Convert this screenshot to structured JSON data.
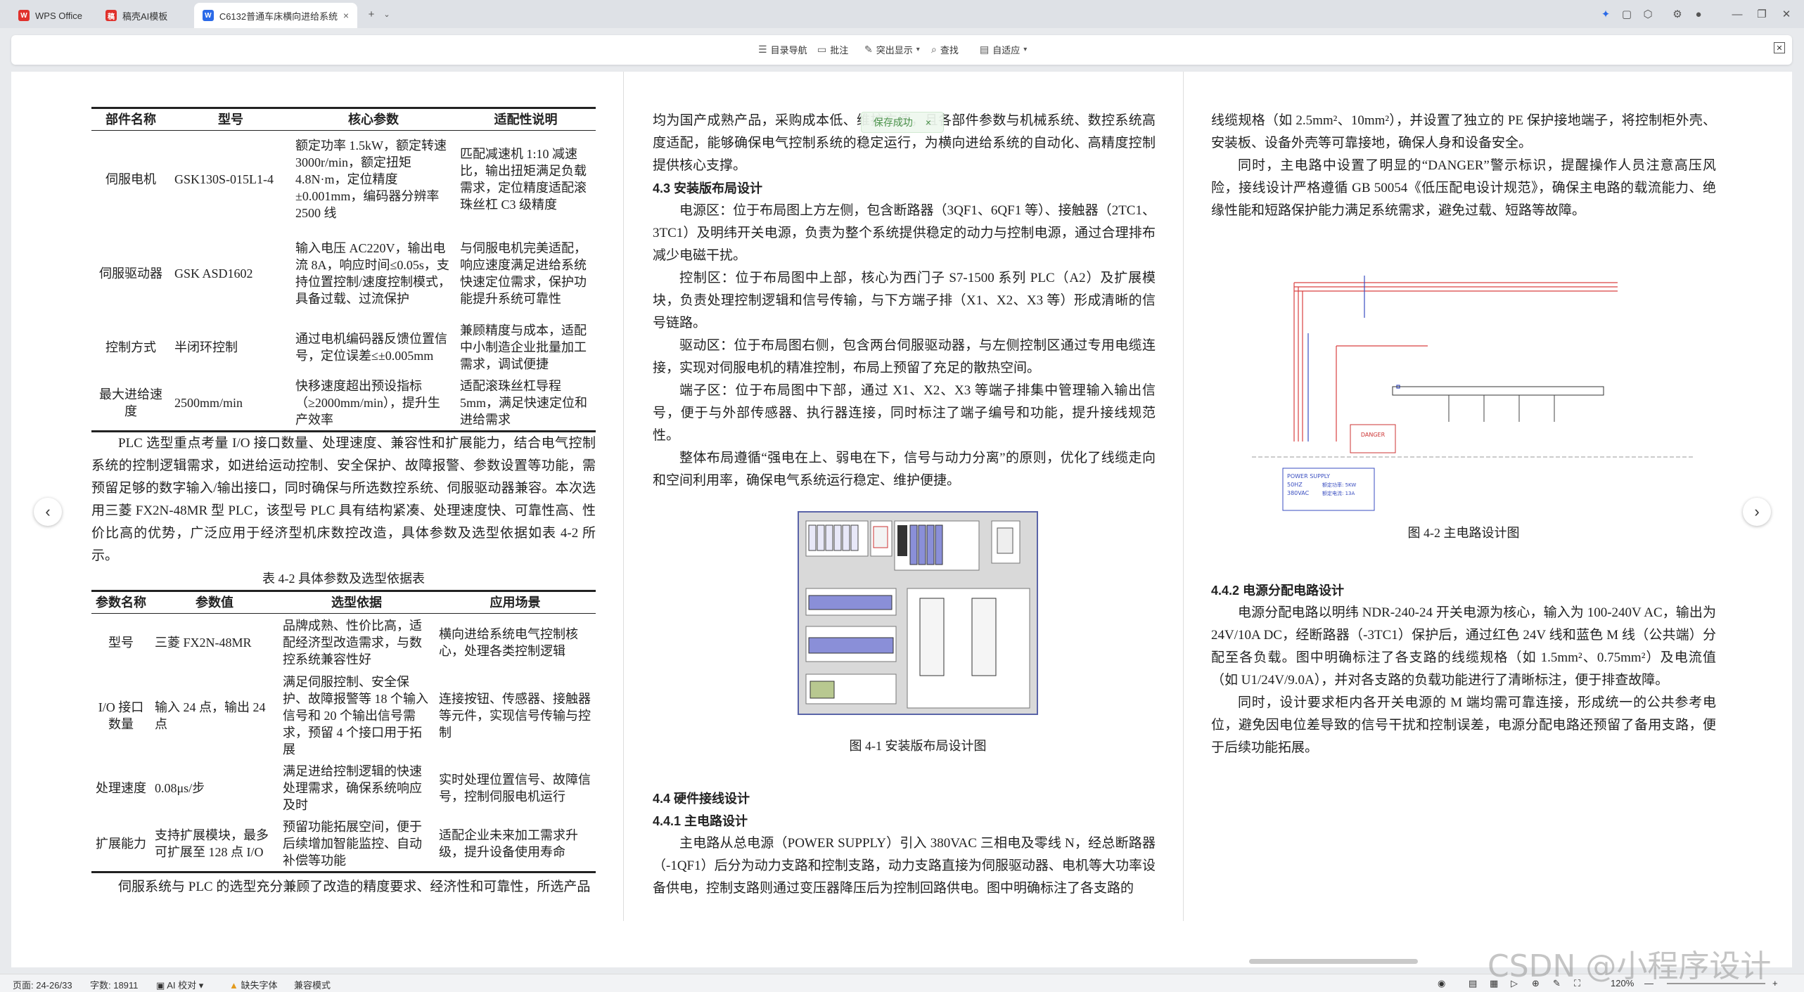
{
  "tabs": [
    {
      "label": "WPS Office",
      "icon": "W",
      "color": "#e0312c"
    },
    {
      "label": "稿壳AI模板",
      "icon": "稿",
      "color": "#e0312c"
    },
    {
      "label": "C6132普通车床横向进给系统",
      "icon": "W",
      "color": "#2b6ae8"
    }
  ],
  "toolbar": {
    "nav": "目录导航",
    "comment": "批注",
    "highlight": "突出显示",
    "find": "查找",
    "adaptive": "自适应"
  },
  "toast": {
    "text": "保存成功",
    "close": "×"
  },
  "col1": {
    "table1": {
      "headers": [
        "部件名称",
        "型号",
        "核心参数",
        "适配性说明"
      ],
      "rows": [
        [
          "伺服电机",
          "GSK130S-015L1-4",
          "额定功率 1.5kW，额定转速 3000r/min，额定扭矩 4.8N·m，定位精度 ±0.001mm，编码器分辨率 2500 线",
          "匹配减速机 1:10 减速比，输出扭矩满足负载需求，定位精度适配滚珠丝杠 C3 级精度"
        ],
        [
          "伺服驱动器",
          "GSK ASD1602",
          "输入电压 AC220V，输出电流 8A，响应时间≤0.05s，支持位置控制/速度控制模式，具备过载、过流保护",
          "与伺服电机完美适配，响应速度满足进给系统快速定位需求，保护功能提升系统可靠性"
        ],
        [
          "控制方式",
          "半闭环控制",
          "通过电机编码器反馈位置信号，定位误差≤±0.005mm",
          "兼顾精度与成本，适配中小制造企业批量加工需求，调试便捷"
        ],
        [
          "最大进给速度",
          "2500mm/min",
          "快移速度超出预设指标（≥2000mm/min），提升生产效率",
          "适配滚珠丝杠导程 5mm，满足快速定位和进给需求"
        ]
      ]
    },
    "para1": "PLC 选型重点考量 I/O 接口数量、处理速度、兼容性和扩展能力，结合电气控制系统的控制逻辑需求，如进给运动控制、安全保护、故障报警、参数设置等功能，需预留足够的数字输入/输出接口，同时确保与所选数控系统、伺服驱动器兼容。本次选用三菱 FX2N-48MR 型 PLC，该型号 PLC 具有结构紧凑、处理速度快、可靠性高、性价比高的优势，广泛应用于经济型机床数控改造，具体参数及选型依据如表 4-2 所示。",
    "table2_caption": "表 4-2 具体参数及选型依据表",
    "table2": {
      "headers": [
        "参数名称",
        "参数值",
        "选型依据",
        "应用场景"
      ],
      "rows": [
        [
          "型号",
          "三菱 FX2N-48MR",
          "品牌成熟、性价比高，适配经济型改造需求，与数控系统兼容性好",
          "横向进给系统电气控制核心，处理各类控制逻辑"
        ],
        [
          "I/O 接口数量",
          "输入 24 点，输出 24 点",
          "满足伺服控制、安全保护、故障报警等 18 个输入信号和 20 个输出信号需求，预留 4 个接口用于拓展",
          "连接按钮、传感器、接触器等元件，实现信号传输与控制"
        ],
        [
          "处理速度",
          "0.08μs/步",
          "满足进给控制逻辑的快速处理需求，确保系统响应及时",
          "实时处理位置信号、故障信号，控制伺服电机运行"
        ],
        [
          "扩展能力",
          "支持扩展模块，最多可扩展至 128 点 I/O",
          "预留功能拓展空间，便于后续增加智能监控、自动补偿等功能",
          "适配企业未来加工需求升级，提升设备使用寿命"
        ]
      ]
    },
    "para2": "伺服系统与 PLC 的选型充分兼顾了改造的精度要求、经济性和可靠性，所选产品"
  },
  "col2": {
    "para0": "均为国产成熟产品，采购成本低、维护方便，且各部件参数与机械系统、数控系统高度适配，能够确保电气控制系统的稳定运行，为横向进给系统的自动化、高精度控制提供核心支撑。",
    "h43": "4.3  安装版布局设计",
    "p1": "电源区：位于布局图上方左侧，包含断路器（3QF1、6QF1 等）、接触器（2TC1、3TC1）及明纬开关电源，负责为整个系统提供稳定的动力与控制电源，通过合理排布减少电磁干扰。",
    "p2": "控制区：位于布局图中上部，核心为西门子 S7-1500 系列 PLC（A2）及扩展模块，负责处理控制逻辑和信号传输，与下方端子排（X1、X2、X3 等）形成清晰的信号链路。",
    "p3": "驱动区：位于布局图右侧，包含两台伺服驱动器，与左侧控制区通过专用电缆连接，实现对伺服电机的精准控制，布局上预留了充足的散热空间。",
    "p4": "端子区：位于布局图中下部，通过 X1、X2、X3 等端子排集中管理输入输出信号，便于与外部传感器、执行器连接，同时标注了端子编号和功能，提升接线规范性。",
    "p5": "整体布局遵循“强电在上、弱电在下，信号与动力分离”的原则，优化了线缆走向和空间利用率，确保电气系统运行稳定、维护便捷。",
    "fig1_caption": "图 4-1  安装版布局设计图",
    "h44": "4.4  硬件接线设计",
    "h441": "4.4.1  主电路设计",
    "p6": "主电路从总电源（POWER SUPPLY）引入 380VAC 三相电及零线 N，经总断路器（-1QF1）后分为动力支路和控制支路，动力支路直接为伺服驱动器、电机等大功率设备供电，控制支路则通过变压器降压后为控制回路供电。图中明确标注了各支路的"
  },
  "col3": {
    "p1": "线缆规格（如 2.5mm²、10mm²），并设置了独立的 PE 保护接地端子，将控制柜外壳、安装板、设备外壳等可靠接地，确保人身和设备安全。",
    "p2": "同时，主电路中设置了明显的“DANGER”警示标识，提醒操作人员注意高压风险，接线设计严格遵循 GB 50054《低压配电设计规范》，确保主电路的载流能力、绝缘性能和短路保护能力满足系统需求，避免过载、短路等故障。",
    "fig2_caption": "图 4-2  主电路设计图",
    "h442": "4.4.2  电源分配电路设计",
    "p3": "电源分配电路以明纬 NDR-240-24 开关电源为核心，输入为 100-240V AC，输出为 24V/10A DC，经断路器（-3TC1）保护后，通过红色 24V 线和蓝色 M 线（公共端）分配至各负载。图中明确标注了各支路的线缆规格（如 1.5mm²、0.75mm²）及电流值（如 U1/24V/9.0A），并对各支路的负载功能进行了清晰标注，便于排查故障。",
    "p4": "同时，设计要求柜内各开关电源的 M 端均需可靠连接，形成统一的公共参考电位，避免因电位差导致的信号干扰和控制误差，电源分配电路还预留了备用支路，便于后续功能拓展。"
  },
  "fig2": {
    "danger": "DANGER",
    "power": "POWER SUPPLY",
    "voltage": "380VAC",
    "label1": "额定功率: 5KW",
    "label2": "额定电流: 13A",
    "freq": "50HZ"
  },
  "status": {
    "page": "页面: 24-26/33",
    "words": "字数: 18911",
    "ai": "AI 校对",
    "font": "缺失字体",
    "compat": "兼容模式",
    "zoom": "120%"
  },
  "watermark": "CSDN @小程序设计"
}
